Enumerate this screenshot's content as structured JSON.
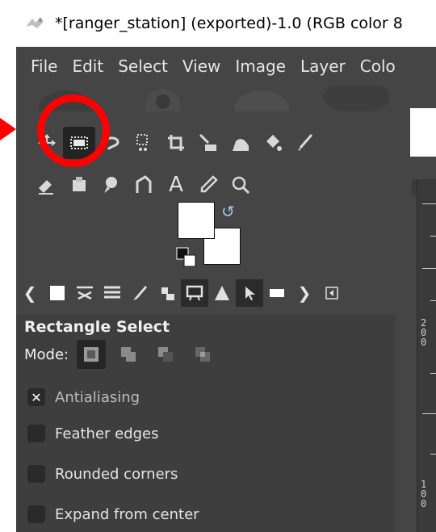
{
  "window": {
    "title": "*[ranger_station] (exported)-1.0 (RGB color 8"
  },
  "menu": {
    "items": [
      "File",
      "Edit",
      "Select",
      "View",
      "Image",
      "Layer",
      "Colo"
    ]
  },
  "toolbox": {
    "row1_icons": [
      "move-tool-icon",
      "rectangle-select-icon",
      "free-select-icon",
      "fuzzy-select-icon",
      "crop-icon",
      "unified-transform-icon",
      "warp-transform-icon",
      "bucket-fill-icon",
      "paintbrush-icon"
    ],
    "row2_icons": [
      "eraser-icon",
      "clone-icon",
      "smudge-icon",
      "paths-icon",
      "text-icon",
      "color-picker-icon",
      "zoom-icon"
    ],
    "text_tool_glyph": "A"
  },
  "colors": {
    "foreground": "#ffffff",
    "background": "#ffffff"
  },
  "dock_tabs": [
    "tab-tool-options",
    "tab-device-status",
    "tab-undo-history",
    "tab-brushes",
    "tab-patterns",
    "tab-fonts",
    "tab-gradients",
    "tab-pointer",
    "tab-images"
  ],
  "tool_options": {
    "title": "Rectangle Select",
    "mode_label": "Mode:",
    "antialiasing": {
      "label": "Antialiasing",
      "checked": true,
      "mark": "✕"
    },
    "feather_edges": {
      "label": "Feather edges",
      "checked": false
    },
    "rounded_corners": {
      "label": "Rounded corners",
      "checked": false
    },
    "expand_from_center": {
      "label": "Expand from center",
      "checked": false
    }
  },
  "ruler": {
    "label_a": [
      "2",
      "0",
      "0"
    ],
    "label_b": [
      "1",
      "0",
      "0"
    ]
  },
  "annotation": {
    "highlight_color": "#ff0000"
  }
}
